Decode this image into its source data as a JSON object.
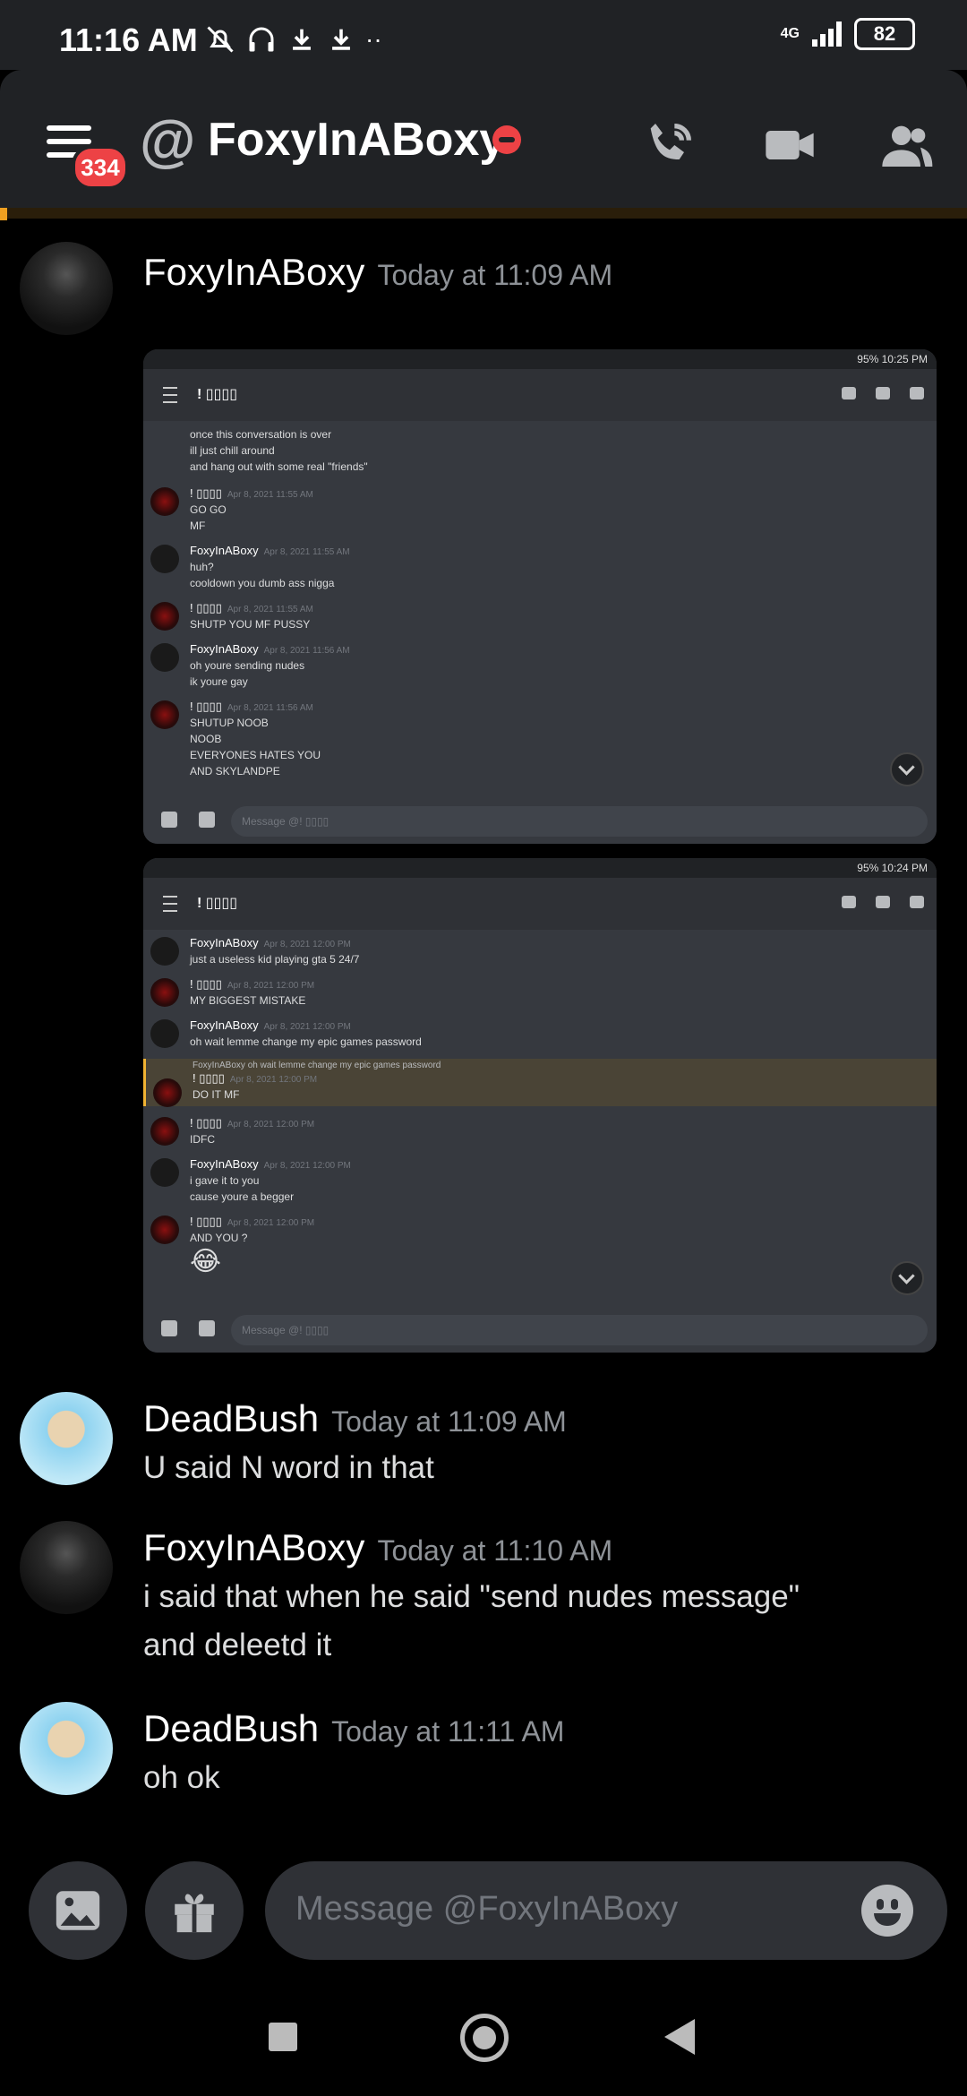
{
  "status_bar": {
    "time": "11:16 AM",
    "network": "4G",
    "battery": "82"
  },
  "header": {
    "title": "FoxyInABoxy",
    "badge_count": "334"
  },
  "messages": [
    {
      "author": "FoxyInABoxy",
      "timestamp": "Today at 11:09 AM",
      "lines": []
    },
    {
      "author": "DeadBush",
      "timestamp": "Today at 11:09 AM",
      "lines": [
        "U said N word in that"
      ]
    },
    {
      "author": "FoxyInABoxy",
      "timestamp": "Today at 11:10 AM",
      "lines": [
        "i said that when he said \"send nudes message\"",
        "and deleetd it"
      ]
    },
    {
      "author": "DeadBush",
      "timestamp": "Today at 11:11 AM",
      "lines": [
        "oh ok"
      ]
    }
  ],
  "attachment1": {
    "status_right": "95% 10:25 PM",
    "channel": "! ▯▯▯▯",
    "top_lines": [
      "once this conversation is over",
      "ill just  chill around",
      "and hang out with some real \"friends\""
    ],
    "messages": [
      {
        "author": "! ▯▯▯▯",
        "date": "Apr 8, 2021 11:55 AM",
        "lines": [
          "GO GO",
          "MF"
        ]
      },
      {
        "author": "FoxyInABoxy",
        "date": "Apr 8, 2021 11:55 AM",
        "lines": [
          "huh?",
          "cooldown you dumb ass nigga"
        ]
      },
      {
        "author": "! ▯▯▯▯",
        "date": "Apr 8, 2021 11:55 AM",
        "lines": [
          "SHUTP  YOU MF PUSSY"
        ]
      },
      {
        "author": "FoxyInABoxy",
        "date": "Apr 8, 2021 11:56 AM",
        "lines": [
          "oh youre sending nudes",
          "ik youre gay"
        ]
      },
      {
        "author": "! ▯▯▯▯",
        "date": "Apr 8, 2021 11:56 AM",
        "lines": [
          "SHUTUP NOOB",
          "NOOB",
          "EVERYONES HATES YOU",
          "AND SKYLANDPE"
        ]
      }
    ],
    "input_placeholder": "Message @! ▯▯▯▯"
  },
  "attachment2": {
    "status_right": "95% 10:24 PM",
    "channel": "! ▯▯▯▯",
    "messages": [
      {
        "author": "FoxyInABoxy",
        "date": "Apr 8, 2021 12:00 PM",
        "lines": [
          "just a useless kid playing gta 5 24/7"
        ]
      },
      {
        "author": "! ▯▯▯▯",
        "date": "Apr 8, 2021 12:00 PM",
        "lines": [
          "MY BIGGEST MISTAKE"
        ]
      },
      {
        "author": "FoxyInABoxy",
        "date": "Apr 8, 2021 12:00 PM",
        "lines": [
          "oh wait lemme change my epic games password"
        ]
      },
      {
        "author": "! ▯▯▯▯",
        "date": "Apr 8, 2021 12:00 PM",
        "lines": [
          "DO IT MF"
        ],
        "reply_to": "FoxyInABoxy oh wait lemme change my epic games password"
      },
      {
        "author": "! ▯▯▯▯",
        "date": "Apr 8, 2021 12:00 PM",
        "lines": [
          "IDFC"
        ]
      },
      {
        "author": "FoxyInABoxy",
        "date": "Apr 8, 2021 12:00 PM",
        "lines": [
          "i gave it to you",
          "cause youre a begger"
        ]
      },
      {
        "author": "! ▯▯▯▯",
        "date": "Apr 8, 2021 12:00 PM",
        "lines": [
          "AND YOU ?",
          "😂"
        ]
      }
    ],
    "input_placeholder": "Message @! ▯▯▯▯"
  },
  "composer": {
    "placeholder": "Message @FoxyInABoxy"
  },
  "icons": {
    "menu": "hamburger-icon",
    "call": "phone-call-icon",
    "video": "video-camera-icon",
    "members": "members-icon",
    "image": "image-icon",
    "gift": "gift-icon",
    "emoji": "emoji-icon"
  },
  "colors": {
    "background": "#000000",
    "header": "#202225",
    "input": "#2f3136",
    "badge": "#ed4245",
    "dnd": "#ed4245"
  }
}
